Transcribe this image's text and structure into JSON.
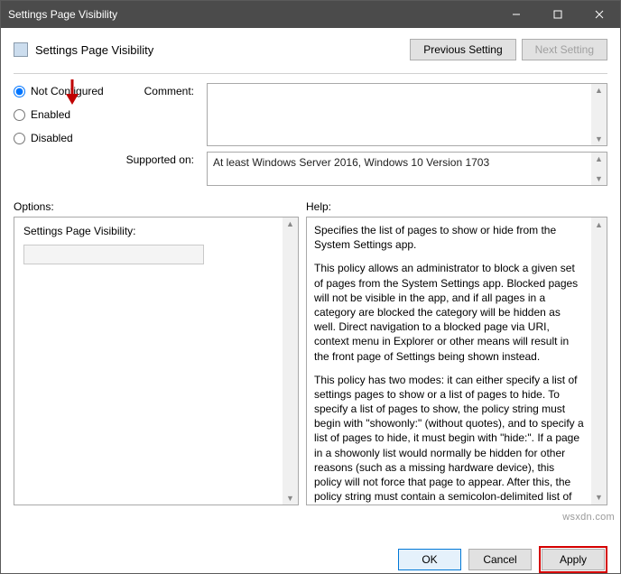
{
  "window": {
    "title": "Settings Page Visibility"
  },
  "header": {
    "title": "Settings Page Visibility"
  },
  "nav": {
    "prev": "Previous Setting",
    "next": "Next Setting"
  },
  "state": {
    "not_configured": "Not Configured",
    "enabled": "Enabled",
    "disabled": "Disabled"
  },
  "labels": {
    "comment": "Comment:",
    "supported": "Supported on:",
    "options": "Options:",
    "help": "Help:"
  },
  "supported_text": "At least Windows Server 2016, Windows 10 Version 1703",
  "options": {
    "field_label": "Settings Page Visibility:"
  },
  "help": {
    "p1": "Specifies the list of pages to show or hide from the System Settings app.",
    "p2": "This policy allows an administrator to block a given set of pages from the System Settings app. Blocked pages will not be visible in the app, and if all pages in a category are blocked the category will be hidden as well. Direct navigation to a blocked page via URI, context menu in Explorer or other means will result in the front page of Settings being shown instead.",
    "p3": "This policy has two modes: it can either specify a list of settings pages to show or a list of pages to hide. To specify a list of pages to show, the policy string must begin with \"showonly:\" (without quotes), and to specify a list of pages to hide, it must begin with \"hide:\". If a page in a showonly list would normally be hidden for other reasons (such as a missing hardware device), this policy will not force that page to appear. After this, the policy string must contain a semicolon-delimited list of settings page identifiers. The identifier for any given settings page is the published URI for that page, minus the \"ms-settings:\" protocol part."
  },
  "footer": {
    "ok": "OK",
    "cancel": "Cancel",
    "apply": "Apply"
  },
  "watermark": "wsxdn.com"
}
